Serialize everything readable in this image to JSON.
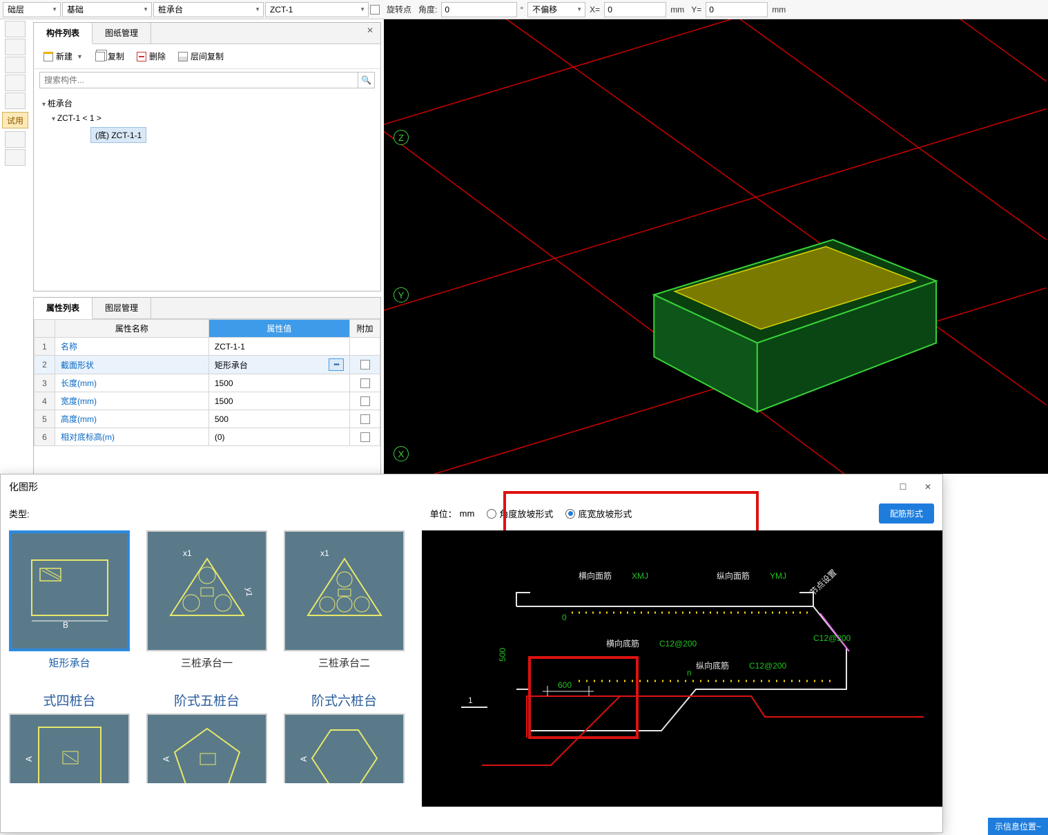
{
  "toolbar": {
    "floor": "础层",
    "type": "基础",
    "category": "桩承台",
    "name": "ZCT-1",
    "rotate_chk_label": "旋转点",
    "angle_label": "角度:",
    "angle_value": "0",
    "offset_mode": "不偏移",
    "x_label": "X=",
    "x_value": "0",
    "mm1": "mm",
    "y_label": "Y=",
    "y_value": "0",
    "mm2": "mm"
  },
  "left_strip": {
    "trial_label": "试用"
  },
  "component_panel": {
    "tab1": "构件列表",
    "tab2": "图纸管理",
    "new_label": "新建",
    "copy_label": "复制",
    "del_label": "删除",
    "layer_label": "层间复制",
    "search_placeholder": "搜索构件...",
    "tree_root": "桩承台",
    "tree_child": "ZCT-1  < 1 >",
    "tree_leaf": "(底)  ZCT-1-1"
  },
  "property_panel": {
    "tab1": "属性列表",
    "tab2": "图层管理",
    "col_name": "属性名称",
    "col_value": "属性值",
    "col_extra": "附加",
    "rows": [
      {
        "n": "1",
        "name": "名称",
        "val": "ZCT-1-1",
        "extra": false
      },
      {
        "n": "2",
        "name": "截面形状",
        "val": "矩形承台",
        "extra": false,
        "active": true,
        "editable": true
      },
      {
        "n": "3",
        "name": "长度(mm)",
        "val": "1500",
        "extra": false
      },
      {
        "n": "4",
        "name": "宽度(mm)",
        "val": "1500",
        "extra": false
      },
      {
        "n": "5",
        "name": "高度(mm)",
        "val": "500",
        "extra": false
      },
      {
        "n": "6",
        "name": "相对底标高(m)",
        "val": "(0)",
        "extra": false
      }
    ]
  },
  "axes": {
    "z": "Z",
    "y": "Y",
    "x": "X"
  },
  "dialog": {
    "title": "化图形",
    "type_label": "类型:",
    "unit_label": "单位：",
    "unit_value": "mm",
    "radio1": "角度放坡形式",
    "radio2": "底宽放坡形式",
    "btn_rebar": "配筋形式",
    "thumbs": [
      {
        "cap": "矩形承台",
        "selected": true
      },
      {
        "cap": "三桩承台一"
      },
      {
        "cap": "三桩承台二"
      },
      {
        "cap": "式四桩台",
        "partial": true
      },
      {
        "cap": "阶式五桩台",
        "partial": true
      },
      {
        "cap": "阶式六桩台",
        "partial": true
      }
    ],
    "drawing": {
      "hx_top": "横向面筋",
      "hx_top_code": "XMJ",
      "zx_top": "纵向面筋",
      "zx_top_code": "YMJ",
      "corner": "节点设置",
      "hx_bot": "横向底筋",
      "hx_bot_code": "C12@200",
      "zx_bot": "纵向底筋",
      "zx_bot_code": "C12@200",
      "right_code": "C12@200",
      "h": "500",
      "zero": "0",
      "dim_600": "600",
      "dim_1": "1",
      "dim_n": "n"
    }
  },
  "status": "示信息位置~"
}
